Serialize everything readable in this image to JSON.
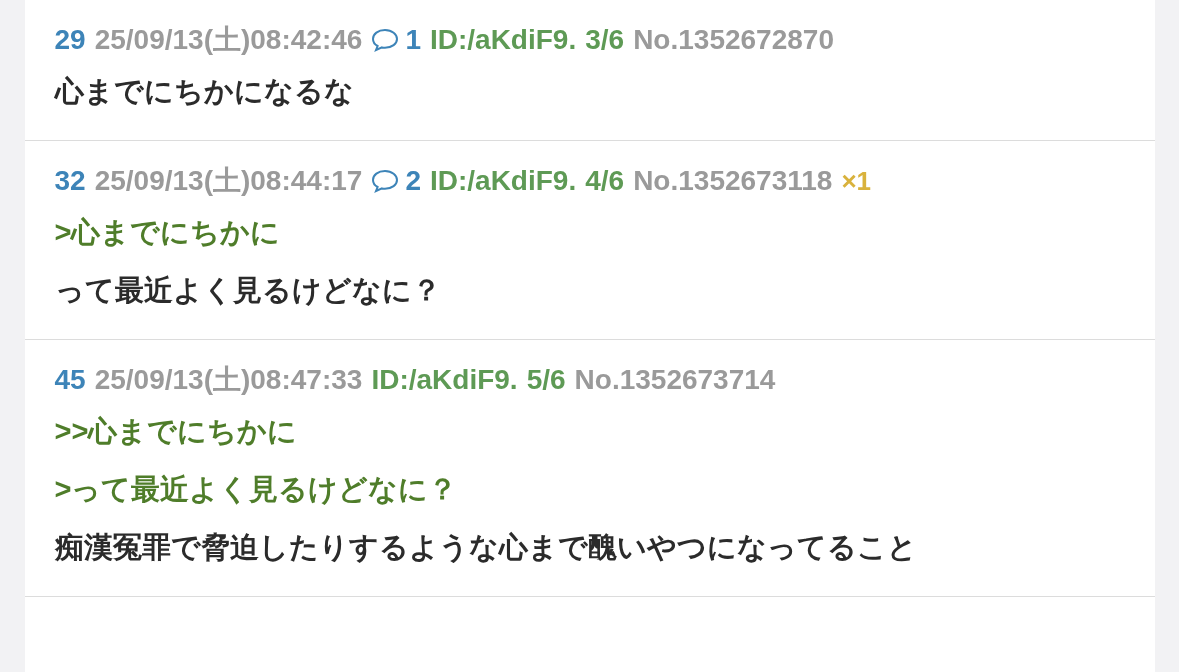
{
  "posts": [
    {
      "number": "29",
      "date": "25/09/13(土)08:42:46",
      "replies": "1",
      "id": "ID:/aKdiF9.",
      "id_count": "3/6",
      "no": "No.1352672870",
      "lines": [
        {
          "kind": "text",
          "text": "心までにちかになるな"
        }
      ]
    },
    {
      "number": "32",
      "date": "25/09/13(土)08:44:17",
      "replies": "2",
      "id": "ID:/aKdiF9.",
      "id_count": "4/6",
      "no": "No.1352673118",
      "ref_count": "×1",
      "lines": [
        {
          "kind": "quote",
          "text": ">心までにちかに"
        },
        {
          "kind": "text",
          "text": "って最近よく見るけどなに？"
        }
      ]
    },
    {
      "number": "45",
      "date": "25/09/13(土)08:47:33",
      "id": "ID:/aKdiF9.",
      "id_count": "5/6",
      "no": "No.1352673714",
      "lines": [
        {
          "kind": "quote",
          "text": ">>心までにちかに"
        },
        {
          "kind": "quote",
          "text": ">って最近よく見るけどなに？"
        },
        {
          "kind": "text",
          "text": "痴漢冤罪で脅迫したりするような心まで醜いやつになってること"
        }
      ]
    }
  ]
}
